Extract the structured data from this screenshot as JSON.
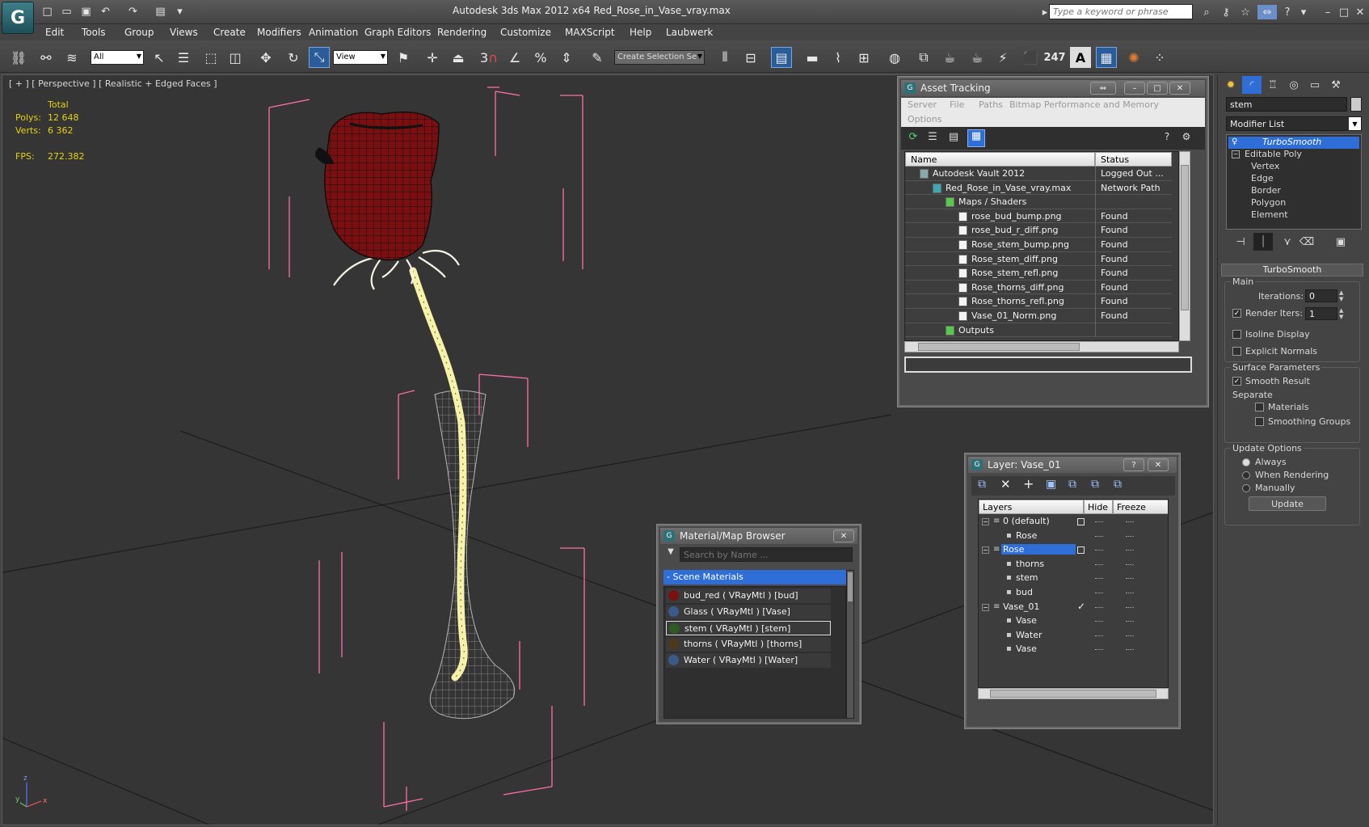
{
  "window": {
    "title": "Autodesk 3ds Max  2012 x64      Red_Rose_in_Vase_vray.max",
    "search_placeholder": "Type a keyword or phrase"
  },
  "menu": [
    "Edit",
    "Tools",
    "Group",
    "Views",
    "Create",
    "Modifiers",
    "Animation",
    "Graph Editors",
    "Rendering",
    "Customize",
    "MAXScript",
    "Help",
    "Laubwerk"
  ],
  "toolbar": {
    "selection_filter": "All",
    "reference_coord": "View",
    "snap_count": "3",
    "named_selection_placeholder": "Create Selection Se",
    "counter": "247",
    "text_tool": "A"
  },
  "viewport": {
    "label": "[ + ] [ Perspective ] [ Realistic + Edged Faces ]",
    "stats": {
      "total_label": "Total",
      "polys_label": "Polys:",
      "polys_value": "12 648",
      "verts_label": "Verts:",
      "verts_value": "6 362",
      "fps_label": "FPS:",
      "fps_value": "272.382"
    },
    "axis": {
      "x": "x",
      "y": "y",
      "z": "z"
    }
  },
  "command_panel": {
    "object_name": "stem",
    "modifier_list": "Modifier List",
    "stack": [
      "TurboSmooth",
      "Editable Poly",
      "Vertex",
      "Edge",
      "Border",
      "Polygon",
      "Element"
    ],
    "rollout_title": "TurboSmooth",
    "main": {
      "group": "Main",
      "iterations_label": "Iterations:",
      "iterations_value": "0",
      "render_iters_label": "Render Iters:",
      "render_iters_value": "1",
      "isoline_label": "Isoline Display",
      "explicit_normals_label": "Explicit Normals"
    },
    "surface": {
      "group": "Surface Parameters",
      "smooth_result_label": "Smooth Result",
      "separate_label": "Separate",
      "materials_label": "Materials",
      "smoothing_groups_label": "Smoothing Groups"
    },
    "update": {
      "group": "Update Options",
      "always": "Always",
      "when_rendering": "When Rendering",
      "manually": "Manually",
      "button": "Update"
    }
  },
  "asset_tracking": {
    "title": "Asset Tracking",
    "menu": [
      "Server",
      "File",
      "Paths",
      "Bitmap Performance and Memory"
    ],
    "menu2": [
      "Options"
    ],
    "columns": [
      "Name",
      "Status"
    ],
    "rows": [
      {
        "name": "Autodesk Vault 2012",
        "status": "Logged Out ...",
        "indent": 0,
        "kind": "vault"
      },
      {
        "name": "Red_Rose_in_Vase_vray.max",
        "status": "Network Path",
        "indent": 1,
        "kind": "max"
      },
      {
        "name": "Maps / Shaders",
        "status": "",
        "indent": 2,
        "kind": "folder"
      },
      {
        "name": "rose_bud_bump.png",
        "status": "Found",
        "indent": 3,
        "kind": "png"
      },
      {
        "name": "rose_bud_r_diff.png",
        "status": "Found",
        "indent": 3,
        "kind": "png"
      },
      {
        "name": "Rose_stem_bump.png",
        "status": "Found",
        "indent": 3,
        "kind": "png"
      },
      {
        "name": "Rose_stem_diff.png",
        "status": "Found",
        "indent": 3,
        "kind": "png"
      },
      {
        "name": "Rose_stem_refl.png",
        "status": "Found",
        "indent": 3,
        "kind": "png"
      },
      {
        "name": "Rose_thorns_diff.png",
        "status": "Found",
        "indent": 3,
        "kind": "png"
      },
      {
        "name": "Rose_thorns_refl.png",
        "status": "Found",
        "indent": 3,
        "kind": "png"
      },
      {
        "name": "Vase_01_Norm.png",
        "status": "Found",
        "indent": 3,
        "kind": "png"
      },
      {
        "name": "Outputs",
        "status": "",
        "indent": 2,
        "kind": "folder"
      }
    ]
  },
  "material_browser": {
    "title": "Material/Map Browser",
    "search_placeholder": "Search by Name ...",
    "group": "- Scene Materials",
    "items": [
      {
        "label": "bud_red  ( VRayMtl ) [bud]",
        "color": "#7a1010"
      },
      {
        "label": "Glass  ( VRayMtl ) [Vase]",
        "color": "#3b5a8a"
      },
      {
        "label": "stem  ( VRayMtl ) [stem]",
        "color": "#2f5a23"
      },
      {
        "label": "thorns  ( VRayMtl ) [thorns]",
        "color": "#4d3a1a"
      },
      {
        "label": "Water  ( VRayMtl ) [Water]",
        "color": "#3b5a8a"
      }
    ]
  },
  "layer_dialog": {
    "title": "Layer: Vase_01",
    "columns": [
      "Layers",
      "Hide",
      "Freeze"
    ],
    "rows": [
      {
        "name": "0 (default)",
        "indent": 0,
        "kind": "layer"
      },
      {
        "name": "Rose",
        "indent": 1,
        "kind": "object"
      },
      {
        "name": "Rose",
        "indent": 0,
        "kind": "layer",
        "selected": true
      },
      {
        "name": "thorns",
        "indent": 1,
        "kind": "object"
      },
      {
        "name": "stem",
        "indent": 1,
        "kind": "object"
      },
      {
        "name": "bud",
        "indent": 1,
        "kind": "object"
      },
      {
        "name": "Vase_01",
        "indent": 0,
        "kind": "layer",
        "current": true
      },
      {
        "name": "Vase",
        "indent": 1,
        "kind": "object"
      },
      {
        "name": "Water",
        "indent": 1,
        "kind": "object"
      },
      {
        "name": "Vase",
        "indent": 1,
        "kind": "object"
      }
    ]
  },
  "colors": {
    "accent": "#2f6ed6",
    "wire_rose": "#ff0000",
    "bbox": "#ff6fa8",
    "stats": "#e7d20c"
  }
}
